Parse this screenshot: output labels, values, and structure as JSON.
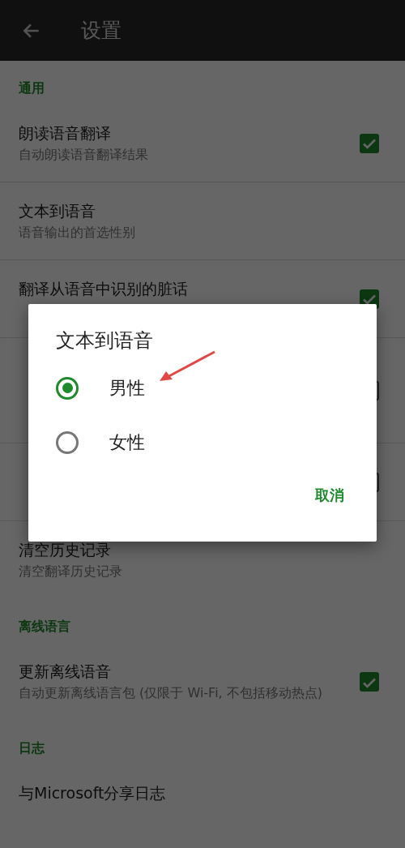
{
  "app_bar": {
    "title": "设置"
  },
  "sections": [
    {
      "header": "通用",
      "items": [
        {
          "kind": "checkbox",
          "title": "朗读语音翻译",
          "subtitle": "自动朗读语音翻译结果",
          "checked": true
        },
        {
          "kind": "plain",
          "title": "文本到语音",
          "subtitle": "语音输出的首选性别"
        },
        {
          "kind": "checkbox",
          "title": "翻译从语音中识别的脏话",
          "checked": true
        },
        {
          "kind": "checkbox",
          "checked": false
        },
        {
          "kind": "checkbox",
          "checked": false
        },
        {
          "kind": "plain",
          "title": "清空历史记录",
          "subtitle": "清空翻译历史记录"
        }
      ]
    },
    {
      "header": "离线语言",
      "items": [
        {
          "kind": "checkbox",
          "title": "更新离线语音",
          "subtitle": "自动更新离线语言包 (仅限于 Wi-Fi, 不包括移动热点)",
          "checked": true
        }
      ]
    },
    {
      "header": "日志",
      "items": [
        {
          "kind": "plain",
          "title": "与Microsoft分享日志"
        }
      ]
    }
  ],
  "dialog": {
    "title": "文本到语音",
    "options": [
      {
        "label": "男性",
        "selected": true
      },
      {
        "label": "女性",
        "selected": false
      }
    ],
    "buttons": [
      "取消"
    ]
  }
}
